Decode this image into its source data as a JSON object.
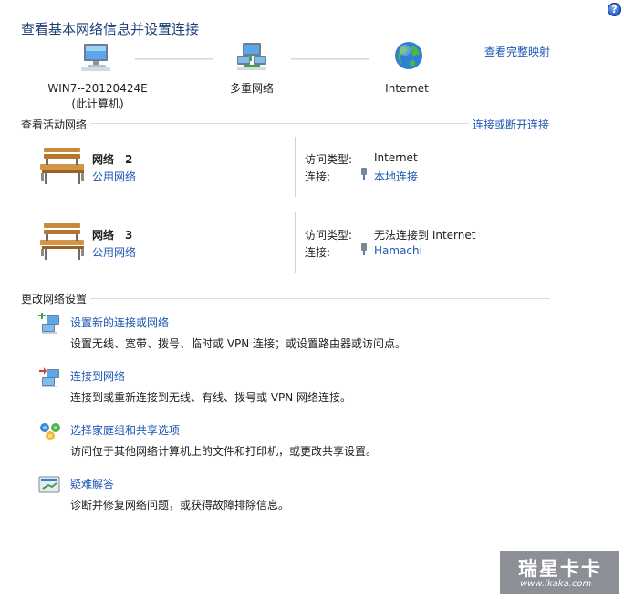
{
  "header": {
    "title": "查看基本网络信息并设置连接",
    "full_map_link": "查看完整映射",
    "help_glyph": "?"
  },
  "map": {
    "computer": "WIN7--20120424E",
    "computer_sub": "(此计算机)",
    "multi_network": "多重网络",
    "internet": "Internet"
  },
  "active": {
    "section_title": "查看活动网络",
    "connect_link": "连接或断开连接",
    "access_type_label": "访问类型:",
    "connection_label": "连接:",
    "networks": [
      {
        "name": "网络　2",
        "category": "公用网络",
        "access_type": "Internet",
        "connection": "本地连接"
      },
      {
        "name": "网络　3",
        "category": "公用网络",
        "access_type": "无法连接到 Internet",
        "connection": "Hamachi"
      }
    ]
  },
  "change": {
    "section_title": "更改网络设置",
    "tasks": [
      {
        "title": "设置新的连接或网络",
        "desc": "设置无线、宽带、拨号、临时或 VPN 连接；或设置路由器或访问点。"
      },
      {
        "title": "连接到网络",
        "desc": "连接到或重新连接到无线、有线、拨号或 VPN 网络连接。"
      },
      {
        "title": "选择家庭组和共享选项",
        "desc": "访问位于其他网络计算机上的文件和打印机，或更改共享设置。"
      },
      {
        "title": "疑难解答",
        "desc": "诊断并修复网络问题，或获得故障排除信息。"
      }
    ]
  },
  "watermark": {
    "main": "瑞星卡卡",
    "sub": "www.ikaka.com"
  }
}
